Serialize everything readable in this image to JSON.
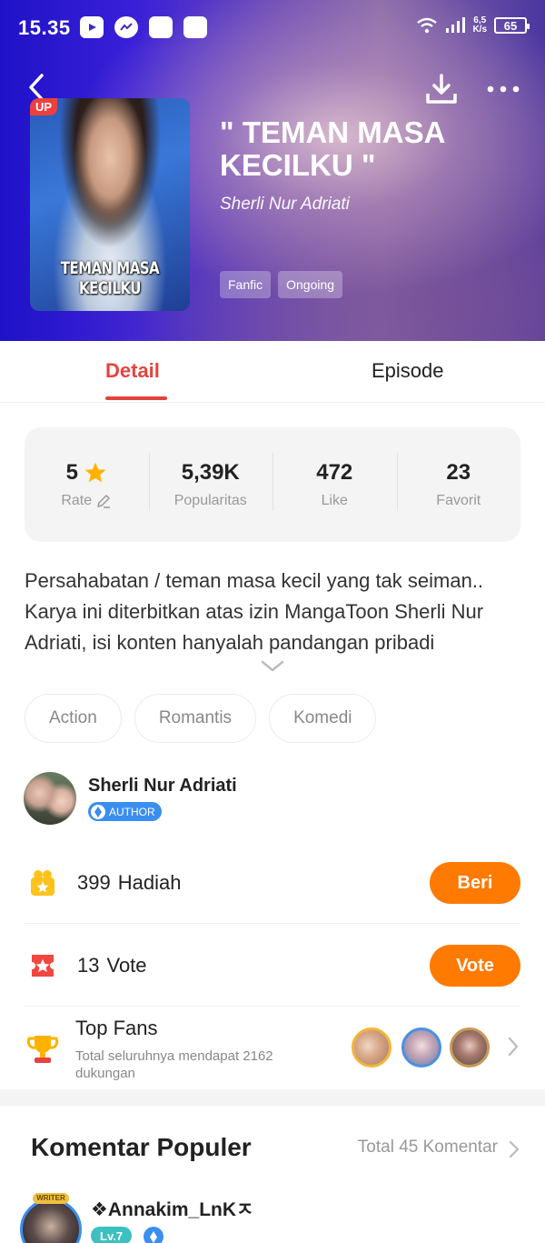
{
  "status_bar": {
    "time": "15.35",
    "speed_value": "6,5",
    "speed_unit": "K/s",
    "battery": "65"
  },
  "cover": {
    "badge": "UP",
    "title_text": "TEMAN MASA KECILKU"
  },
  "book": {
    "title": "\" TEMAN MASA KECILKU \"",
    "author": "Sherli Nur Adriati",
    "tags": [
      "Fanfic",
      "Ongoing"
    ]
  },
  "tabs": {
    "detail": "Detail",
    "episode": "Episode"
  },
  "stats": [
    {
      "value": "5",
      "label": "Rate"
    },
    {
      "value": "5,39K",
      "label": "Popularitas"
    },
    {
      "value": "472",
      "label": "Like"
    },
    {
      "value": "23",
      "label": "Favorit"
    }
  ],
  "description": "Persahabatan / teman masa kecil yang tak seiman.. Karya ini diterbitkan atas izin MangaToon Sherli Nur Adriati, isi konten hanyalah pandangan pribadi",
  "genres": [
    "Action",
    "Romantis",
    "Komedi"
  ],
  "author": {
    "name": "Sherli Nur Adriati",
    "badge": "AUTHOR"
  },
  "gift": {
    "count": "399",
    "label": "Hadiah",
    "button": "Beri"
  },
  "vote": {
    "count": "13",
    "label": "Vote",
    "button": "Vote"
  },
  "top_fans": {
    "title": "Top Fans",
    "subtitle": "Total seluruhnya mendapat 2162 dukungan"
  },
  "comments": {
    "title": "Komentar Populer",
    "total": "Total 45 Komentar",
    "first": {
      "name": "❖Annakim_LnKㅈ",
      "level": "Lv.7",
      "frame_text": "WRITER"
    }
  },
  "colors": {
    "accent": "#e5433f",
    "button": "#ff7a00",
    "badge_blue": "#3a8ef0",
    "star": "#ffb300"
  },
  "icons": {
    "back": "chevron-left-icon",
    "download": "download-icon",
    "more": "more-dots-icon",
    "gift": "gift-icon",
    "vote": "ticket-icon",
    "fans": "trophy-icon"
  }
}
